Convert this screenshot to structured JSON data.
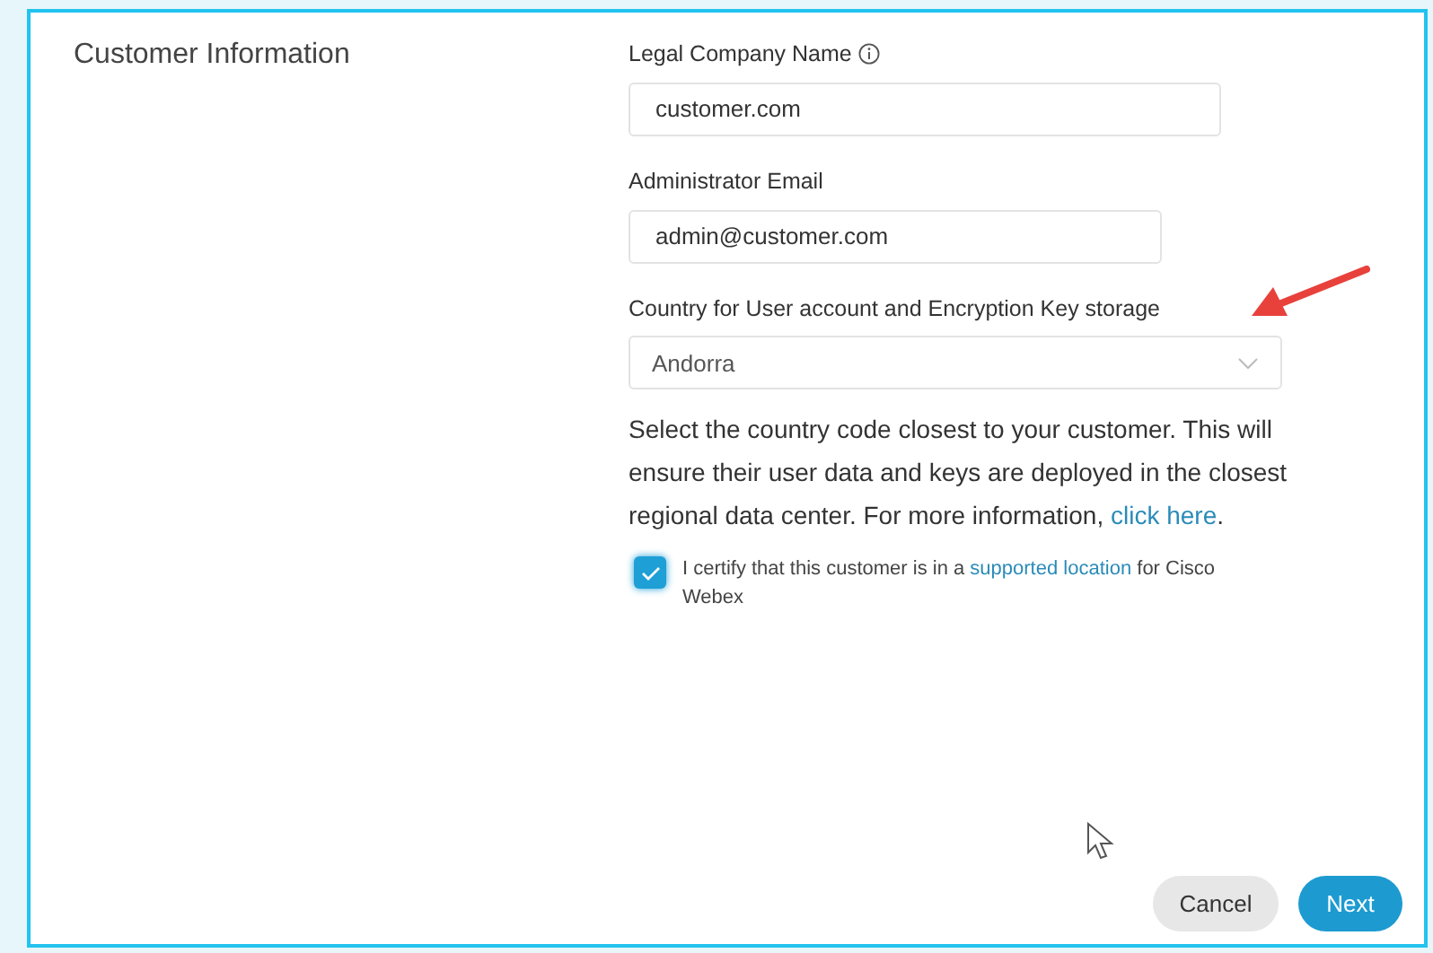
{
  "section_title": "Customer Information",
  "fields": [
    {
      "kind": "text",
      "label": "Legal Company Name",
      "info_icon": true,
      "value": "customer.com"
    },
    {
      "kind": "text",
      "label": "Administrator Email",
      "info_icon": false,
      "value": "admin@customer.com"
    },
    {
      "kind": "select",
      "label": "Country for User account and Encryption Key storage",
      "info_icon": false,
      "value": "Andorra"
    }
  ],
  "help": {
    "text_before": "Select the country code closest to your customer. This will ensure their user data and keys are deployed in the closest regional data center. For more information, ",
    "link": "click here",
    "text_after": "."
  },
  "certify": {
    "checked": true,
    "text_before": "I certify that this customer is in a ",
    "link": "supported location",
    "text_after": " for Cisco Webex"
  },
  "buttons": [
    {
      "label": "Cancel",
      "kind": "secondary"
    },
    {
      "label": "Next",
      "kind": "primary"
    }
  ]
}
